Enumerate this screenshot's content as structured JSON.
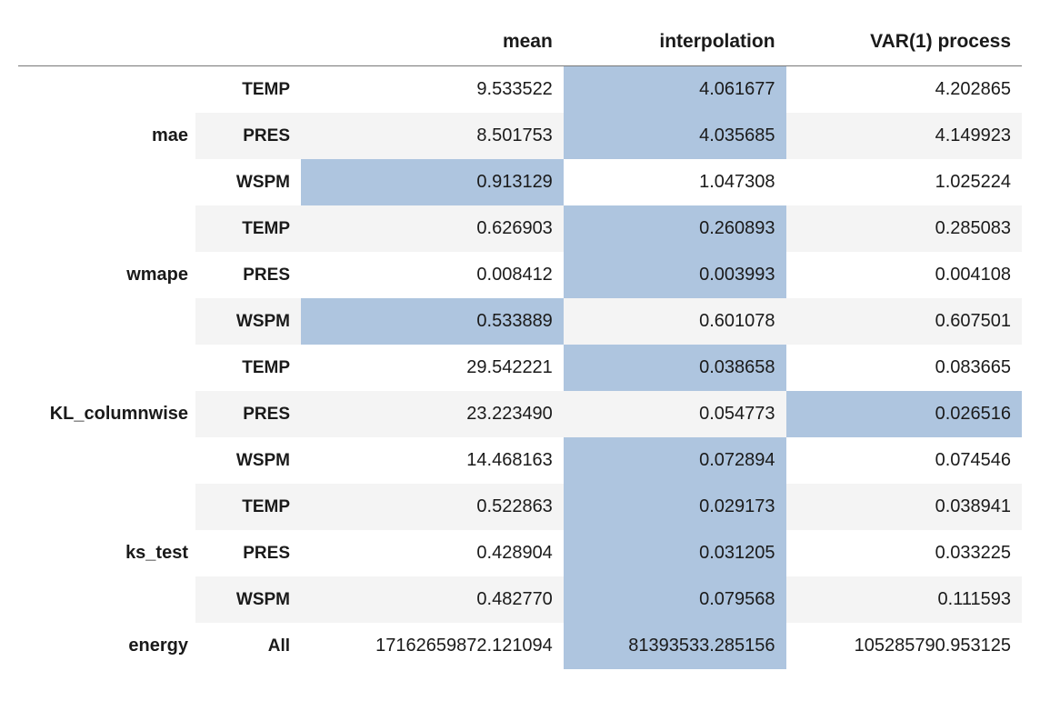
{
  "columns": {
    "c1": "mae",
    "c2": "wmape",
    "c3": "KL_columnwise",
    "c4": "ks_test",
    "c5": "energy",
    "sub_temp": "TEMP",
    "sub_pres": "PRES",
    "sub_wspm": "WSPM",
    "sub_all": "All",
    "h_mean": "mean",
    "h_interp": "interpolation",
    "h_var": "VAR(1) process"
  },
  "chart_data": {
    "type": "table",
    "groups": [
      {
        "name": "mae",
        "rows": [
          {
            "sub": "TEMP",
            "mean": 9.533522,
            "interpolation": 4.061677,
            "var1": 4.202855,
            "min": "interpolation"
          },
          {
            "sub": "PRES",
            "mean": 8.501753,
            "interpolation": 4.035685,
            "var1": 4.149923,
            "min": "interpolation"
          },
          {
            "sub": "WSPM",
            "mean": 0.913129,
            "interpolation": 1.047308,
            "var1": 1.025224,
            "min": "mean"
          }
        ]
      },
      {
        "name": "wmape",
        "rows": [
          {
            "sub": "TEMP",
            "mean": 0.626903,
            "interpolation": 0.260893,
            "var1": 0.285083,
            "min": "interpolation"
          },
          {
            "sub": "PRES",
            "mean": 0.008412,
            "interpolation": 0.003993,
            "var1": 0.004108,
            "min": "interpolation"
          },
          {
            "sub": "WSPM",
            "mean": 0.533889,
            "interpolation": 0.601078,
            "var1": 0.607501,
            "min": "mean"
          }
        ]
      },
      {
        "name": "KL_columnwise",
        "rows": [
          {
            "sub": "TEMP",
            "mean": 29.542221,
            "interpolation": 0.038658,
            "var1": 0.083665,
            "min": "interpolation"
          },
          {
            "sub": "PRES",
            "mean": 23.22349,
            "interpolation": 0.054773,
            "var1": 0.026516,
            "min": "var1"
          },
          {
            "sub": "WSPM",
            "mean": 14.468163,
            "interpolation": 0.072894,
            "var1": 0.074546,
            "min": "interpolation"
          }
        ]
      },
      {
        "name": "ks_test",
        "rows": [
          {
            "sub": "TEMP",
            "mean": 0.522863,
            "interpolation": 0.029173,
            "var1": 0.038941,
            "min": "interpolation"
          },
          {
            "sub": "PRES",
            "mean": 0.428904,
            "interpolation": 0.031205,
            "var1": 0.033225,
            "min": "interpolation"
          },
          {
            "sub": "WSPM",
            "mean": 0.48277,
            "interpolation": 0.079568,
            "var1": 0.111593,
            "min": "interpolation"
          }
        ]
      },
      {
        "name": "energy",
        "rows": [
          {
            "sub": "All",
            "mean": 17162659872.121094,
            "interpolation": 81393533.285156,
            "var1": 105285790.953125,
            "min": "interpolation"
          }
        ]
      }
    ]
  },
  "cells": {
    "mae": {
      "TEMP": {
        "mean": "9.533522",
        "interp": "4.061677",
        "var": "4.202865"
      },
      "PRES": {
        "mean": "8.501753",
        "interp": "4.035685",
        "var": "4.149923"
      },
      "WSPM": {
        "mean": "0.913129",
        "interp": "1.047308",
        "var": "1.025224"
      }
    },
    "wmape": {
      "TEMP": {
        "mean": "0.626903",
        "interp": "0.260893",
        "var": "0.285083"
      },
      "PRES": {
        "mean": "0.008412",
        "interp": "0.003993",
        "var": "0.004108"
      },
      "WSPM": {
        "mean": "0.533889",
        "interp": "0.601078",
        "var": "0.607501"
      }
    },
    "KL_columnwise": {
      "TEMP": {
        "mean": "29.542221",
        "interp": "0.038658",
        "var": "0.083665"
      },
      "PRES": {
        "mean": "23.223490",
        "interp": "0.054773",
        "var": "0.026516"
      },
      "WSPM": {
        "mean": "14.468163",
        "interp": "0.072894",
        "var": "0.074546"
      }
    },
    "ks_test": {
      "TEMP": {
        "mean": "0.522863",
        "interp": "0.029173",
        "var": "0.038941"
      },
      "PRES": {
        "mean": "0.428904",
        "interp": "0.031205",
        "var": "0.033225"
      },
      "WSPM": {
        "mean": "0.482770",
        "interp": "0.079568",
        "var": "0.111593"
      }
    },
    "energy": {
      "All": {
        "mean": "17162659872.121094",
        "interp": "81393533.285156",
        "var": "105285790.953125"
      }
    }
  }
}
